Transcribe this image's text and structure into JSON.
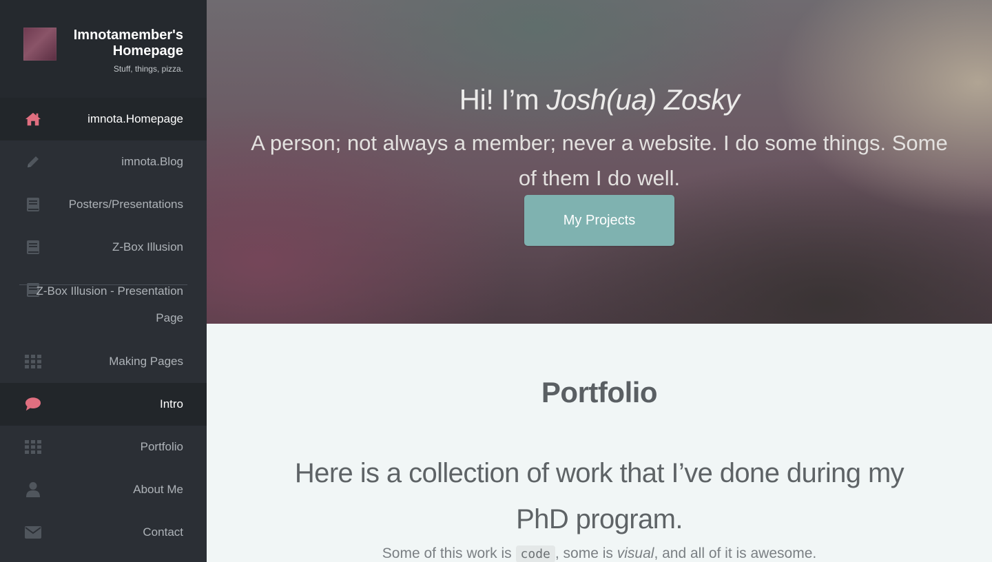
{
  "brand": {
    "title": "Imnotamember's Homepage",
    "subtitle": "Stuff, things, pizza."
  },
  "nav": {
    "items": [
      {
        "label": "imnota.Homepage",
        "icon": "home-icon",
        "active": true
      },
      {
        "label": "imnota.Blog",
        "icon": "pencil-icon",
        "active": false
      },
      {
        "label": "Posters/Presentations",
        "icon": "book-icon",
        "active": false
      },
      {
        "label": "Z-Box Illusion",
        "icon": "book-icon",
        "active": false
      },
      {
        "label": "Z-Box Illusion - Presentation Page",
        "icon": "book-icon",
        "active": false
      },
      {
        "label": "Making Pages",
        "icon": "grid-icon",
        "active": false
      },
      {
        "label": "Intro",
        "icon": "comment-icon",
        "active": true
      },
      {
        "label": "Portfolio",
        "icon": "grid-icon",
        "active": false
      },
      {
        "label": "About Me",
        "icon": "user-icon",
        "active": false
      },
      {
        "label": "Contact",
        "icon": "envelope-icon",
        "active": false
      }
    ]
  },
  "hero": {
    "greeting": "Hi! I’m ",
    "name": "Josh(ua) Zosky",
    "tagline": "A person; not always a member; never a website. I do some things. Some of them I do well.",
    "button_label": "My Projects"
  },
  "portfolio": {
    "title": "Portfolio",
    "lead": "Here is a collection of work that I’ve done during my PhD program.",
    "small_prefix": "Some of this work is ",
    "small_code": "code",
    "small_middle": ", some is ",
    "small_visual": "visual",
    "small_suffix": ", and all of it is awesome."
  },
  "colors": {
    "sidebar_bg": "#2b2f35",
    "active_icon": "#e06f80",
    "button_bg": "#7fb2b0"
  }
}
